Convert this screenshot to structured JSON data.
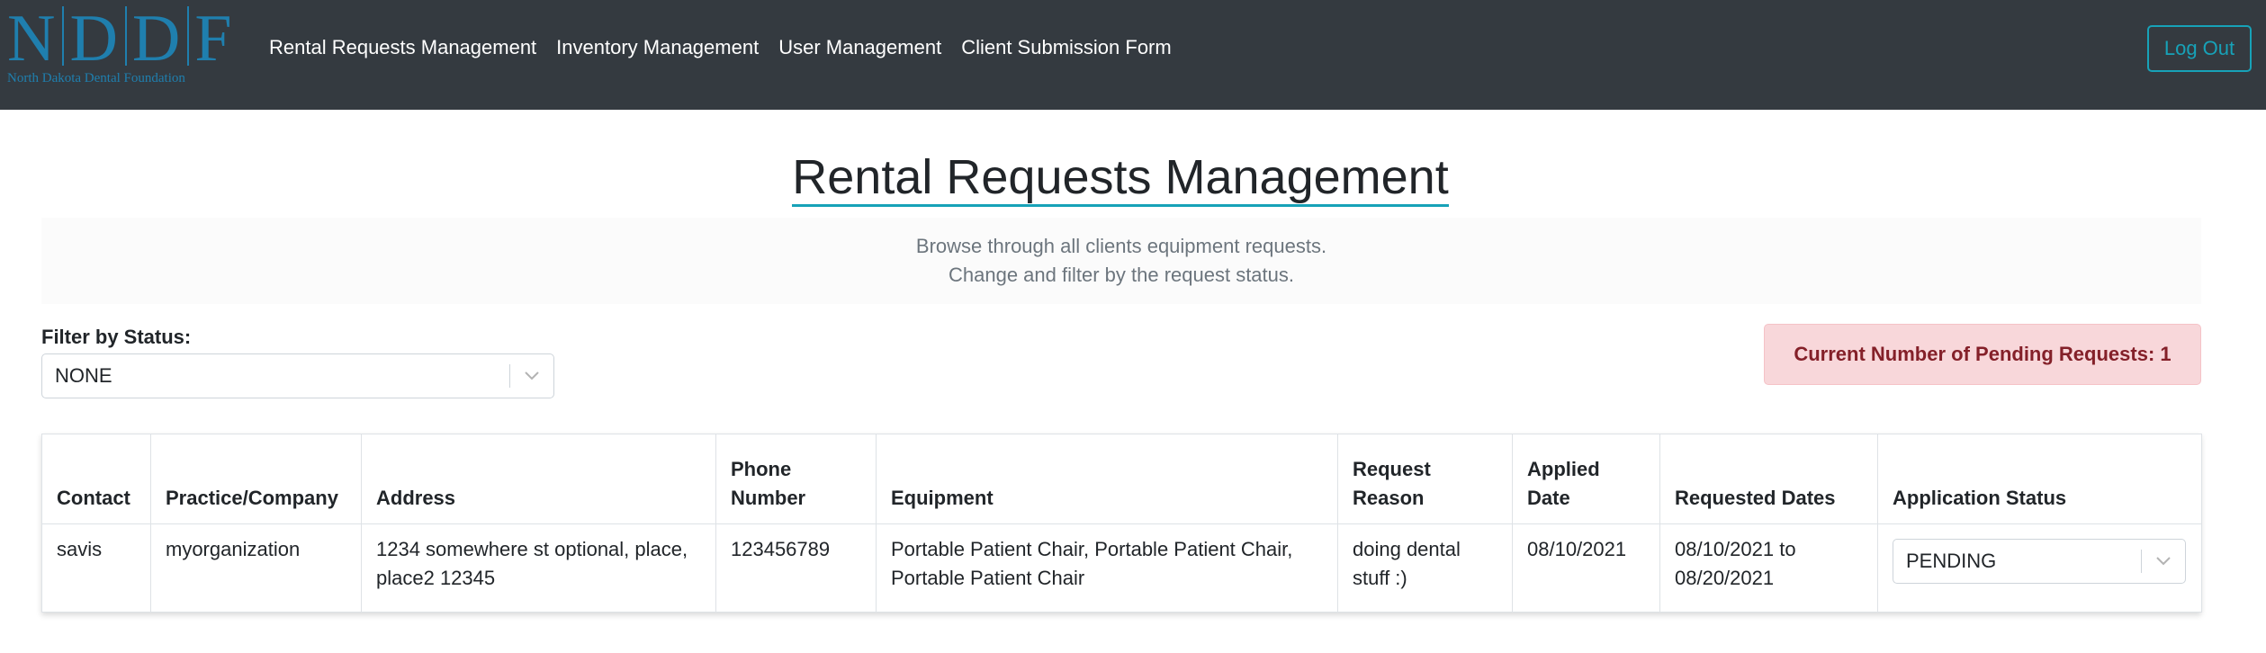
{
  "logo": {
    "letters": [
      "N",
      "D",
      "D",
      "F"
    ],
    "subtitle": "North Dakota Dental Foundation"
  },
  "nav": {
    "links": [
      {
        "label": "Rental Requests Management"
      },
      {
        "label": "Inventory Management"
      },
      {
        "label": "User Management"
      },
      {
        "label": "Client Submission Form"
      }
    ],
    "logout_label": "Log Out"
  },
  "page": {
    "title": "Rental Requests Management",
    "intro_lines": [
      "Browse through all clients equipment requests.",
      "Change and filter by the request status."
    ]
  },
  "filter": {
    "label": "Filter by Status:",
    "selected": "NONE"
  },
  "alert": {
    "text": "Current Number of Pending Requests: 1"
  },
  "table": {
    "headers": [
      "Contact",
      "Practice/Company",
      "Address",
      "Phone Number",
      "Equipment",
      "Request Reason",
      "Applied Date",
      "Requested Dates",
      "Application Status"
    ],
    "rows": [
      {
        "contact": "savis",
        "company": "myorganization",
        "address": "1234 somewhere st optional, place, place2 12345",
        "phone": "123456789",
        "equipment": "Portable Patient Chair, Portable Patient Chair, Portable Patient Chair",
        "reason": "doing dental stuff :)",
        "applied_date": "08/10/2021",
        "requested_dates": "08/10/2021 to 08/20/2021",
        "status": "PENDING"
      }
    ]
  },
  "colors": {
    "navbar": "#343a40",
    "logo": "#1f7fae",
    "accent": "#17a2b8",
    "alert_bg": "#f8d7da",
    "alert_text": "#842029"
  },
  "icons": {
    "select_arrow": "chevron-down-icon"
  }
}
